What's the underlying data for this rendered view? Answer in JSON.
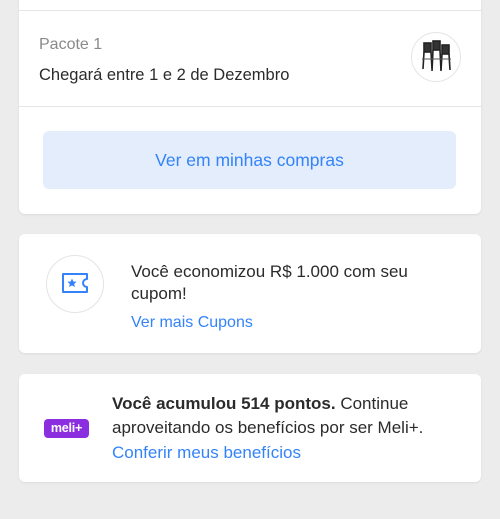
{
  "package": {
    "label": "Pacote 1",
    "arrival": "Chegará entre 1 e 2 de Dezembro",
    "view_purchases_label": "Ver em minhas compras"
  },
  "coupon": {
    "icon": "coupon-ticket-icon",
    "message": "Você economizou R$ 1.000 com seu cupom!",
    "link_label": "Ver mais Cupons"
  },
  "loyalty": {
    "badge_label": "meli+",
    "points_message": "Você acumulou 514 pontos.",
    "message_rest": "Continue aproveitando os benefícios por ser Meli+.",
    "link_label": "Conferir meus benefícios"
  },
  "colors": {
    "accent": "#3483fa",
    "button_bg": "#e3edfb",
    "meli_badge": "#8b2ee0",
    "background": "#ececec"
  }
}
